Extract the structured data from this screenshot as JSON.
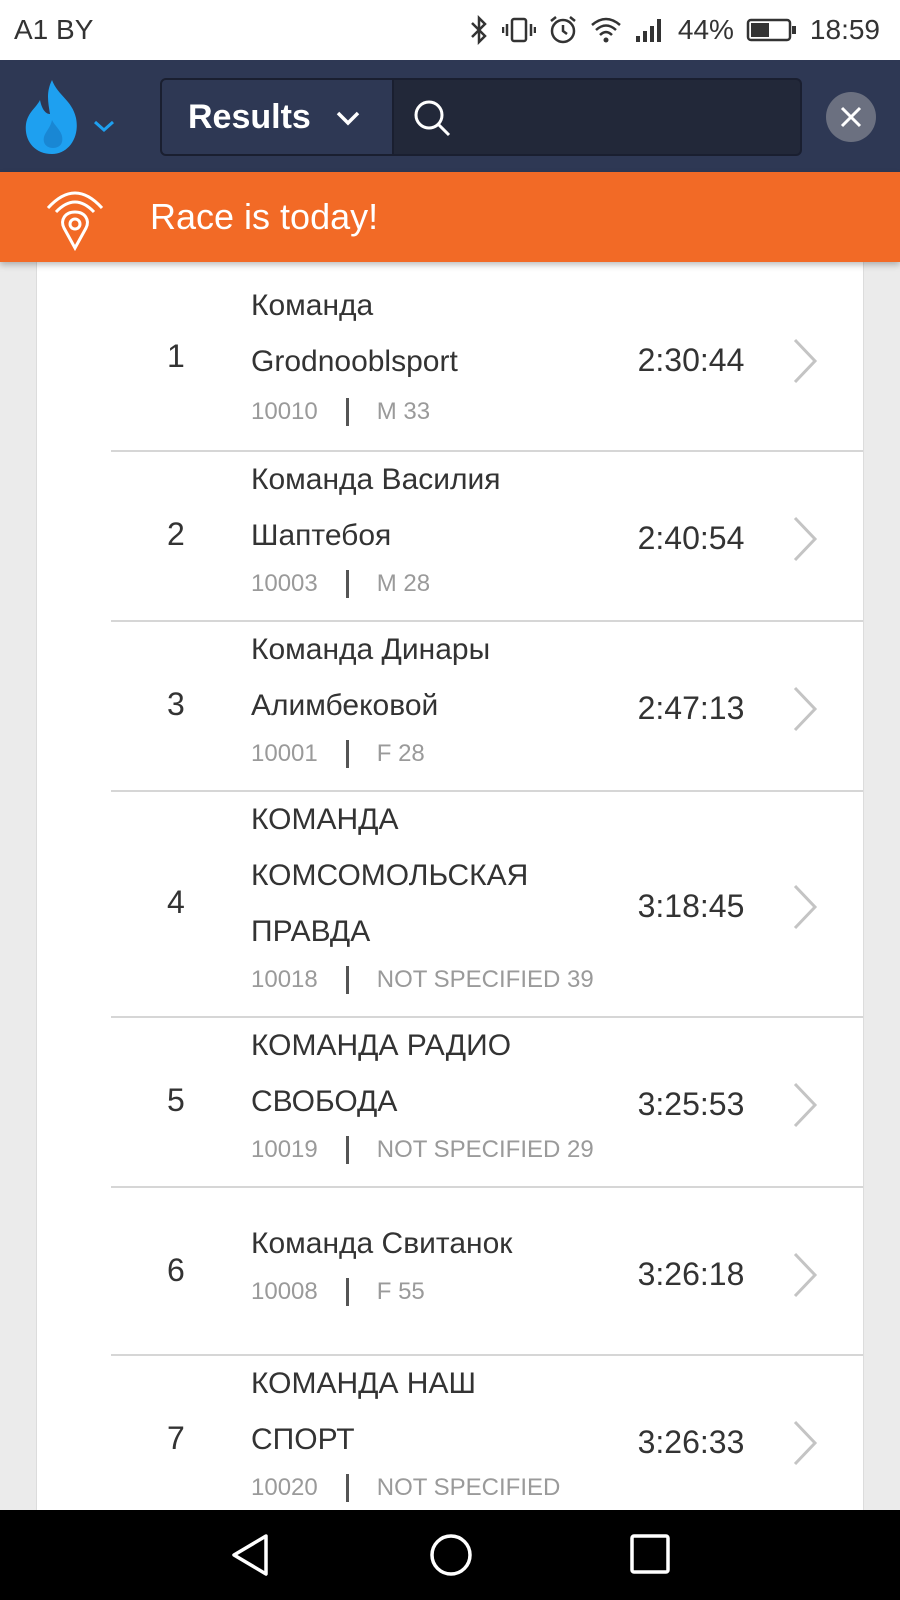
{
  "status": {
    "carrier": "A1 BY",
    "battery": "44%",
    "time": "18:59"
  },
  "header": {
    "logo": "flame-logo",
    "mode_label": "Results",
    "search_placeholder": "",
    "accent": "#2e3854"
  },
  "banner": {
    "text": "Race is today!",
    "color": "#f26a26"
  },
  "results": [
    {
      "rank": "1",
      "name_lines": [
        "Команда",
        "Grodnooblsport"
      ],
      "bib": "10010",
      "category": "M 33",
      "time": "2:30:44"
    },
    {
      "rank": "2",
      "name_lines": [
        "Команда Василия",
        "Шаптебоя"
      ],
      "bib": "10003",
      "category": "M 28",
      "time": "2:40:54"
    },
    {
      "rank": "3",
      "name_lines": [
        "Команда Динары",
        "Алимбековой"
      ],
      "bib": "10001",
      "category": "F 28",
      "time": "2:47:13"
    },
    {
      "rank": "4",
      "name_lines": [
        "КОМАНДА",
        "КОМСОМОЛЬСКАЯ",
        "ПРАВДА"
      ],
      "bib": "10018",
      "category": "NOT SPECIFIED 39",
      "time": "3:18:45"
    },
    {
      "rank": "5",
      "name_lines": [
        "КОМАНДА РАДИО",
        "СВОБОДА"
      ],
      "bib": "10019",
      "category": "NOT SPECIFIED 29",
      "time": "3:25:53"
    },
    {
      "rank": "6",
      "name_lines": [
        "Команда Свитанок"
      ],
      "bib": "10008",
      "category": "F 55",
      "time": "3:26:18"
    },
    {
      "rank": "7",
      "name_lines": [
        "КОМАНДА НАШ",
        "СПОРТ"
      ],
      "bib": "10020",
      "category": "NOT SPECIFIED",
      "time": "3:26:33"
    }
  ]
}
